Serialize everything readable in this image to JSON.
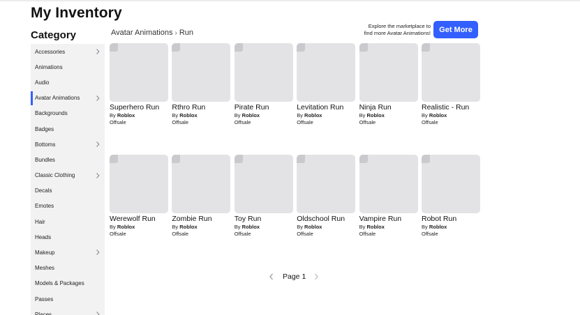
{
  "header": {
    "title": "My Inventory",
    "category_heading": "Category"
  },
  "sidebar": {
    "items": [
      {
        "label": "Accessories",
        "has_chevron": true,
        "active": false
      },
      {
        "label": "Animations",
        "has_chevron": false,
        "active": false
      },
      {
        "label": "Audio",
        "has_chevron": false,
        "active": false
      },
      {
        "label": "Avatar Animations",
        "has_chevron": true,
        "active": true
      },
      {
        "label": "Backgrounds",
        "has_chevron": false,
        "active": false
      },
      {
        "label": "Badges",
        "has_chevron": false,
        "active": false
      },
      {
        "label": "Bottoms",
        "has_chevron": true,
        "active": false
      },
      {
        "label": "Bundles",
        "has_chevron": false,
        "active": false
      },
      {
        "label": "Classic Clothing",
        "has_chevron": true,
        "active": false
      },
      {
        "label": "Decals",
        "has_chevron": false,
        "active": false
      },
      {
        "label": "Emotes",
        "has_chevron": false,
        "active": false
      },
      {
        "label": "Hair",
        "has_chevron": false,
        "active": false
      },
      {
        "label": "Heads",
        "has_chevron": false,
        "active": false
      },
      {
        "label": "Makeup",
        "has_chevron": true,
        "active": false
      },
      {
        "label": "Meshes",
        "has_chevron": false,
        "active": false
      },
      {
        "label": "Models & Packages",
        "has_chevron": false,
        "active": false
      },
      {
        "label": "Passes",
        "has_chevron": false,
        "active": false
      },
      {
        "label": "Places",
        "has_chevron": true,
        "active": false
      }
    ]
  },
  "breadcrumb": {
    "parent": "Avatar Animations",
    "separator": "›",
    "current": "Run"
  },
  "promo": {
    "line1": "Explore the marketplace to",
    "line2": "find more Avatar Animations!",
    "button_label": "Get More"
  },
  "items": [
    {
      "name": "Superhero Run",
      "by": "By",
      "creator": "Roblox",
      "status": "Offsale"
    },
    {
      "name": "Rthro Run",
      "by": "By",
      "creator": "Roblox",
      "status": "Offsale"
    },
    {
      "name": "Pirate Run",
      "by": "By",
      "creator": "Roblox",
      "status": "Offsale"
    },
    {
      "name": "Levitation Run",
      "by": "By",
      "creator": "Roblox",
      "status": "Offsale"
    },
    {
      "name": "Ninja Run",
      "by": "By",
      "creator": "Roblox",
      "status": "Offsale"
    },
    {
      "name": "Realistic - Run",
      "by": "By",
      "creator": "Roblox",
      "status": "Offsale"
    },
    {
      "name": "Werewolf Run",
      "by": "By",
      "creator": "Roblox",
      "status": "Offsale"
    },
    {
      "name": "Zombie Run",
      "by": "By",
      "creator": "Roblox",
      "status": "Offsale"
    },
    {
      "name": "Toy Run",
      "by": "By",
      "creator": "Roblox",
      "status": "Offsale"
    },
    {
      "name": "Oldschool Run",
      "by": "By",
      "creator": "Roblox",
      "status": "Offsale"
    },
    {
      "name": "Vampire Run",
      "by": "By",
      "creator": "Roblox",
      "status": "Offsale"
    },
    {
      "name": "Robot Run",
      "by": "By",
      "creator": "Roblox",
      "status": "Offsale"
    }
  ],
  "pager": {
    "label": "Page 1"
  },
  "colors": {
    "accent": "#335fff",
    "thumbnail_placeholder": "#e3e3e6",
    "sidebar_bg": "#f2f2f3"
  },
  "icons": {
    "sidebar_chevron": "chevron-right-icon",
    "pager_prev": "chevron-left-icon",
    "pager_next": "chevron-right-icon"
  }
}
